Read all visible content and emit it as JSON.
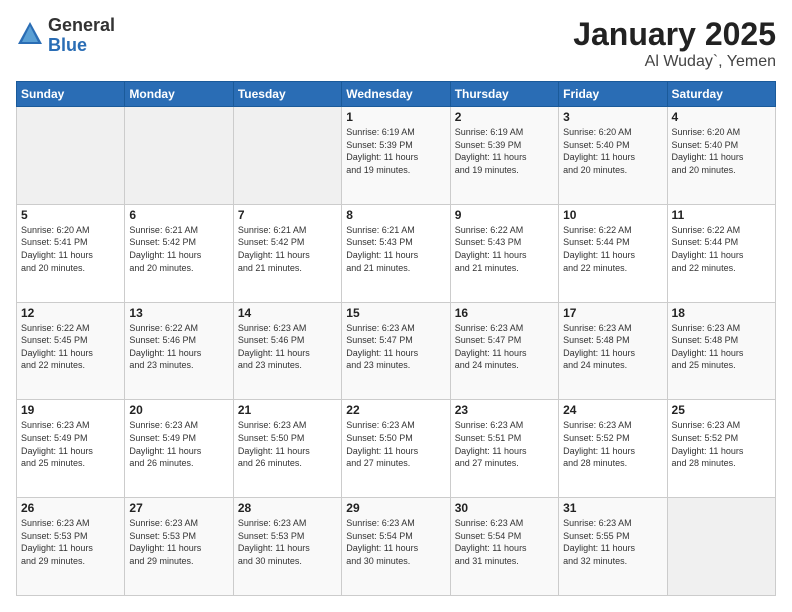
{
  "header": {
    "logo_general": "General",
    "logo_blue": "Blue",
    "title": "January 2025",
    "subtitle": "Al Wuday`, Yemen"
  },
  "weekdays": [
    "Sunday",
    "Monday",
    "Tuesday",
    "Wednesday",
    "Thursday",
    "Friday",
    "Saturday"
  ],
  "weeks": [
    [
      {
        "day": "",
        "info": ""
      },
      {
        "day": "",
        "info": ""
      },
      {
        "day": "",
        "info": ""
      },
      {
        "day": "1",
        "info": "Sunrise: 6:19 AM\nSunset: 5:39 PM\nDaylight: 11 hours\nand 19 minutes."
      },
      {
        "day": "2",
        "info": "Sunrise: 6:19 AM\nSunset: 5:39 PM\nDaylight: 11 hours\nand 19 minutes."
      },
      {
        "day": "3",
        "info": "Sunrise: 6:20 AM\nSunset: 5:40 PM\nDaylight: 11 hours\nand 20 minutes."
      },
      {
        "day": "4",
        "info": "Sunrise: 6:20 AM\nSunset: 5:40 PM\nDaylight: 11 hours\nand 20 minutes."
      }
    ],
    [
      {
        "day": "5",
        "info": "Sunrise: 6:20 AM\nSunset: 5:41 PM\nDaylight: 11 hours\nand 20 minutes."
      },
      {
        "day": "6",
        "info": "Sunrise: 6:21 AM\nSunset: 5:42 PM\nDaylight: 11 hours\nand 20 minutes."
      },
      {
        "day": "7",
        "info": "Sunrise: 6:21 AM\nSunset: 5:42 PM\nDaylight: 11 hours\nand 21 minutes."
      },
      {
        "day": "8",
        "info": "Sunrise: 6:21 AM\nSunset: 5:43 PM\nDaylight: 11 hours\nand 21 minutes."
      },
      {
        "day": "9",
        "info": "Sunrise: 6:22 AM\nSunset: 5:43 PM\nDaylight: 11 hours\nand 21 minutes."
      },
      {
        "day": "10",
        "info": "Sunrise: 6:22 AM\nSunset: 5:44 PM\nDaylight: 11 hours\nand 22 minutes."
      },
      {
        "day": "11",
        "info": "Sunrise: 6:22 AM\nSunset: 5:44 PM\nDaylight: 11 hours\nand 22 minutes."
      }
    ],
    [
      {
        "day": "12",
        "info": "Sunrise: 6:22 AM\nSunset: 5:45 PM\nDaylight: 11 hours\nand 22 minutes."
      },
      {
        "day": "13",
        "info": "Sunrise: 6:22 AM\nSunset: 5:46 PM\nDaylight: 11 hours\nand 23 minutes."
      },
      {
        "day": "14",
        "info": "Sunrise: 6:23 AM\nSunset: 5:46 PM\nDaylight: 11 hours\nand 23 minutes."
      },
      {
        "day": "15",
        "info": "Sunrise: 6:23 AM\nSunset: 5:47 PM\nDaylight: 11 hours\nand 23 minutes."
      },
      {
        "day": "16",
        "info": "Sunrise: 6:23 AM\nSunset: 5:47 PM\nDaylight: 11 hours\nand 24 minutes."
      },
      {
        "day": "17",
        "info": "Sunrise: 6:23 AM\nSunset: 5:48 PM\nDaylight: 11 hours\nand 24 minutes."
      },
      {
        "day": "18",
        "info": "Sunrise: 6:23 AM\nSunset: 5:48 PM\nDaylight: 11 hours\nand 25 minutes."
      }
    ],
    [
      {
        "day": "19",
        "info": "Sunrise: 6:23 AM\nSunset: 5:49 PM\nDaylight: 11 hours\nand 25 minutes."
      },
      {
        "day": "20",
        "info": "Sunrise: 6:23 AM\nSunset: 5:49 PM\nDaylight: 11 hours\nand 26 minutes."
      },
      {
        "day": "21",
        "info": "Sunrise: 6:23 AM\nSunset: 5:50 PM\nDaylight: 11 hours\nand 26 minutes."
      },
      {
        "day": "22",
        "info": "Sunrise: 6:23 AM\nSunset: 5:50 PM\nDaylight: 11 hours\nand 27 minutes."
      },
      {
        "day": "23",
        "info": "Sunrise: 6:23 AM\nSunset: 5:51 PM\nDaylight: 11 hours\nand 27 minutes."
      },
      {
        "day": "24",
        "info": "Sunrise: 6:23 AM\nSunset: 5:52 PM\nDaylight: 11 hours\nand 28 minutes."
      },
      {
        "day": "25",
        "info": "Sunrise: 6:23 AM\nSunset: 5:52 PM\nDaylight: 11 hours\nand 28 minutes."
      }
    ],
    [
      {
        "day": "26",
        "info": "Sunrise: 6:23 AM\nSunset: 5:53 PM\nDaylight: 11 hours\nand 29 minutes."
      },
      {
        "day": "27",
        "info": "Sunrise: 6:23 AM\nSunset: 5:53 PM\nDaylight: 11 hours\nand 29 minutes."
      },
      {
        "day": "28",
        "info": "Sunrise: 6:23 AM\nSunset: 5:53 PM\nDaylight: 11 hours\nand 30 minutes."
      },
      {
        "day": "29",
        "info": "Sunrise: 6:23 AM\nSunset: 5:54 PM\nDaylight: 11 hours\nand 30 minutes."
      },
      {
        "day": "30",
        "info": "Sunrise: 6:23 AM\nSunset: 5:54 PM\nDaylight: 11 hours\nand 31 minutes."
      },
      {
        "day": "31",
        "info": "Sunrise: 6:23 AM\nSunset: 5:55 PM\nDaylight: 11 hours\nand 32 minutes."
      },
      {
        "day": "",
        "info": ""
      }
    ]
  ]
}
